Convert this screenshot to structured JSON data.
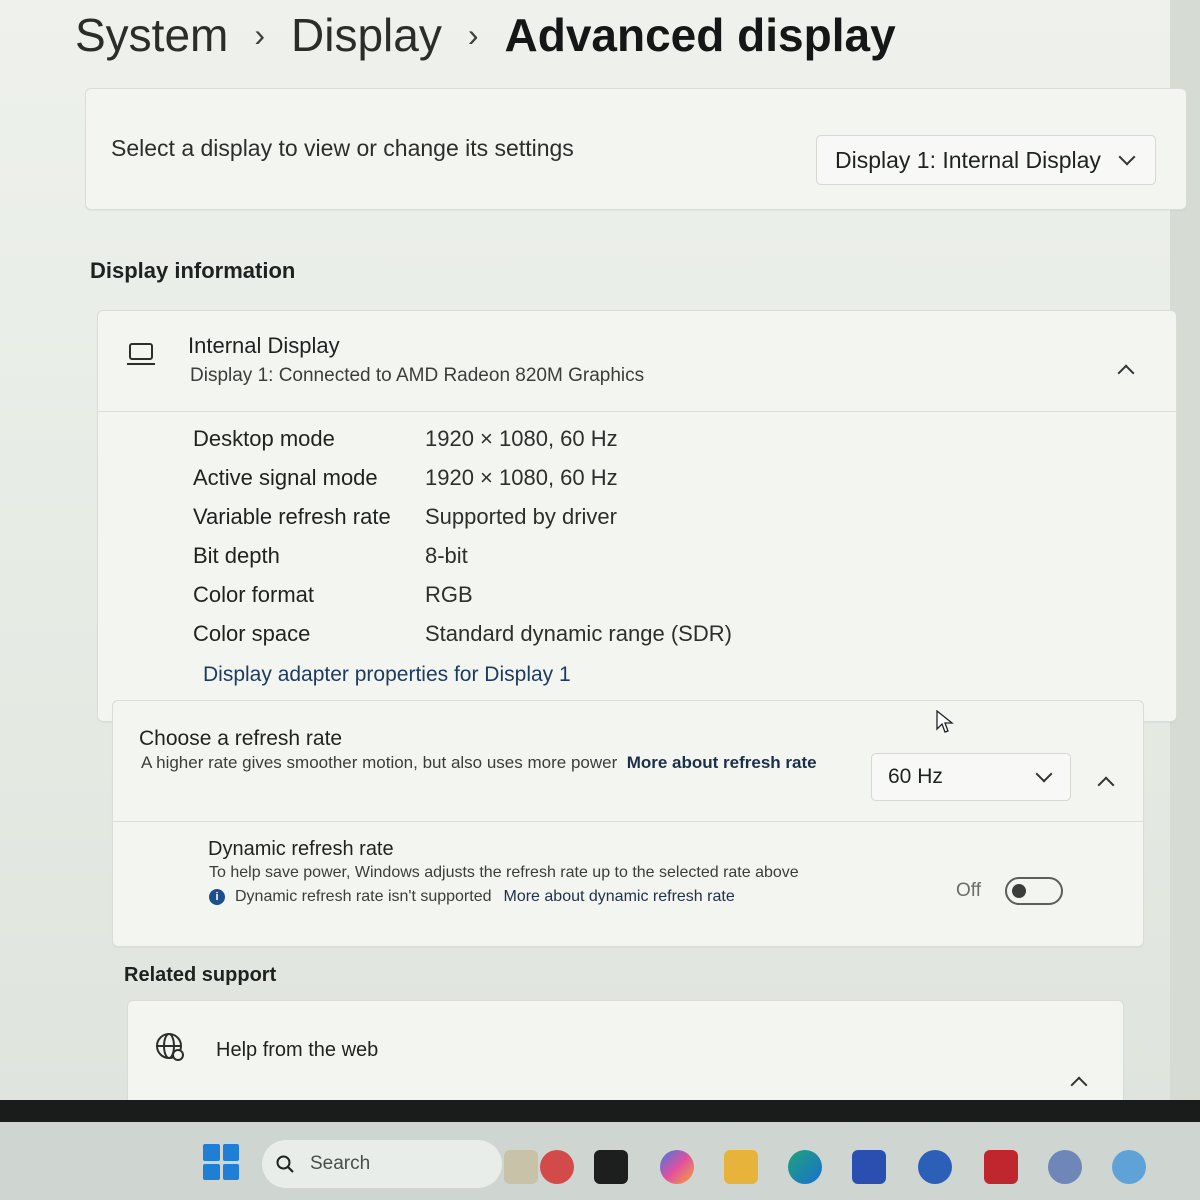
{
  "breadcrumb": {
    "items": [
      "System",
      "Display",
      "Advanced display"
    ],
    "separator": "›"
  },
  "display_select": {
    "label": "Select a display to view or change its settings",
    "selected": "Display 1: Internal Display"
  },
  "display_info": {
    "section_title": "Display information",
    "name": "Internal Display",
    "subtitle": "Display 1: Connected to AMD Radeon 820M Graphics",
    "rows": [
      {
        "key": "Desktop mode",
        "value": "1920 × 1080, 60 Hz"
      },
      {
        "key": "Active signal mode",
        "value": "1920 × 1080, 60 Hz"
      },
      {
        "key": "Variable refresh rate",
        "value": "Supported by driver"
      },
      {
        "key": "Bit depth",
        "value": "8-bit"
      },
      {
        "key": "Color format",
        "value": "RGB"
      },
      {
        "key": "Color space",
        "value": "Standard dynamic range (SDR)"
      }
    ],
    "adapter_link": "Display adapter properties for Display 1"
  },
  "refresh": {
    "title": "Choose a refresh rate",
    "description": "A higher rate gives smoother motion, but also uses more power",
    "link": "More about refresh rate",
    "selected": "60 Hz",
    "dynamic": {
      "title": "Dynamic refresh rate",
      "description": "To help save power, Windows adjusts the refresh rate up to the selected rate above",
      "note": "Dynamic refresh rate isn't supported",
      "note_link": "More about dynamic refresh rate",
      "state_label": "Off",
      "enabled": false
    }
  },
  "related_support": {
    "section_title": "Related support",
    "help_item": "Help from the web"
  },
  "taskbar": {
    "search_placeholder": "Search"
  },
  "colors": {
    "accent": "#1f7fd6",
    "link": "#1e3a5f"
  }
}
